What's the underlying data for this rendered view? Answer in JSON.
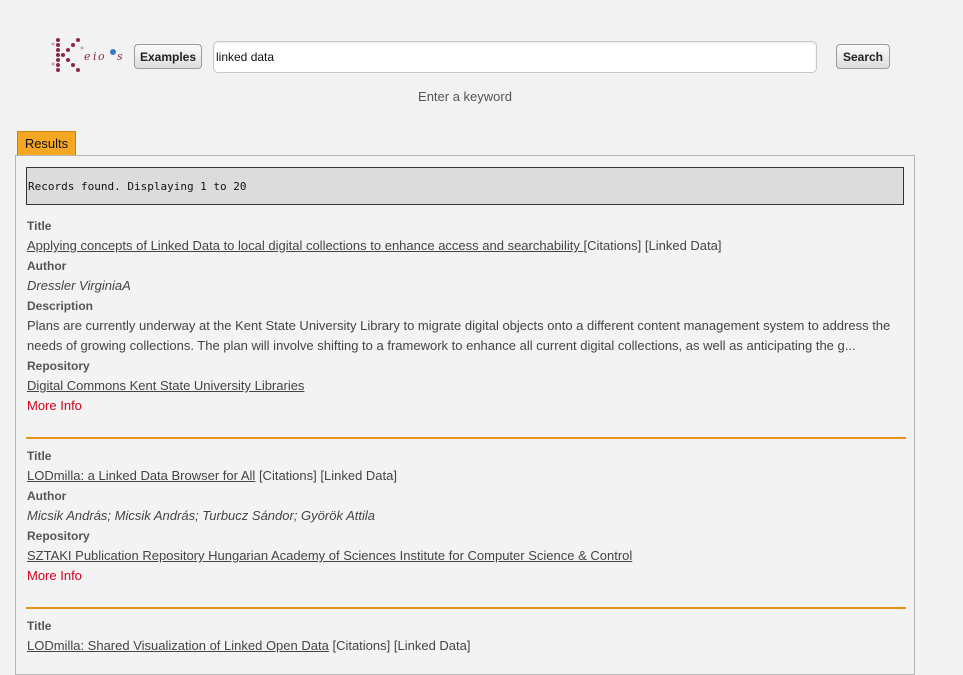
{
  "header": {
    "examples_label": "Examples",
    "search_value": "linked data",
    "search_label": "Search",
    "hint": "Enter a keyword"
  },
  "tabs": {
    "results_label": "Results"
  },
  "results": {
    "records_text": "Records found. Displaying 1 to 20",
    "labels": {
      "title": "Title",
      "author": "Author",
      "description": "Description",
      "repository": "Repository",
      "more_info": "More Info"
    },
    "items": [
      {
        "title": "Applying concepts of Linked Data to local digital collections to enhance access and searchability ",
        "citations": "[Citations]",
        "linked_data": "[Linked Data]",
        "author": "Dressler VirginiaA",
        "description": "Plans are currently underway at the Kent State University Library to migrate digital objects onto a different content management system to address the needs of growing collections. The plan will involve shifting to a framework to enhance all current digital collections, as well as anticipating the g...",
        "repository": "Digital Commons Kent State University Libraries"
      },
      {
        "title": "LODmilla: a Linked Data Browser for All",
        "citations": "[Citations]",
        "linked_data": "[Linked Data]",
        "author": "Micsik András; Micsik András; Turbucz Sándor; Györök Attila",
        "repository": "SZTAKI Publication Repository Hungarian Academy of Sciences Institute for Computer Science & Control"
      },
      {
        "title": "LODmilla: Shared Visualization of Linked Open Data",
        "citations": "[Citations]",
        "linked_data": "[Linked Data]"
      }
    ]
  }
}
